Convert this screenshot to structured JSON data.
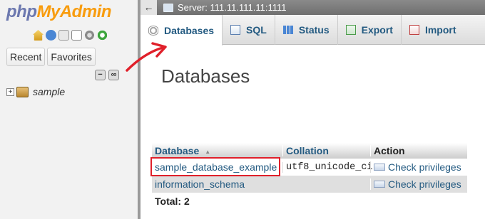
{
  "nav": {
    "logo": {
      "php": "php",
      "my": "My",
      "admin": "Admin"
    },
    "icons": [
      "home-icon",
      "docs-icon",
      "sql-icon",
      "page-icon",
      "settings-icon",
      "reload-icon"
    ],
    "recent_label": "Recent",
    "favorites_label": "Favorites",
    "tree": [
      {
        "name": "sample"
      }
    ]
  },
  "serverbar": {
    "back_glyph": "←",
    "server_label": "Server: 111.11.111.11:1111"
  },
  "tabs": [
    {
      "label": "Databases",
      "active": true
    },
    {
      "label": "SQL"
    },
    {
      "label": "Status"
    },
    {
      "label": "Export"
    },
    {
      "label": "Import"
    }
  ],
  "main": {
    "title": "Databases",
    "table": {
      "headers": {
        "database": "Database",
        "collation": "Collation",
        "action": "Action"
      },
      "rows": [
        {
          "database": "sample_database_example",
          "collation": "utf8_unicode_ci",
          "action": "Check privileges"
        },
        {
          "database": "information_schema",
          "collation": "",
          "action": "Check privileges"
        }
      ],
      "total": "Total: 2"
    }
  },
  "colors": {
    "link": "#235a81",
    "highlight": "#e0202a",
    "logo_php": "#6c78af",
    "logo_myadmin": "#f89c0e"
  }
}
